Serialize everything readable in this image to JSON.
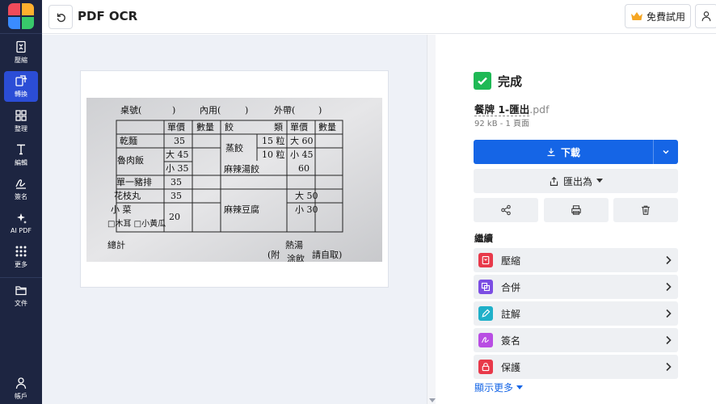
{
  "app": {
    "title": "PDF OCR",
    "trial_label": "免費試用"
  },
  "sidebar": {
    "items": [
      {
        "label": "壓縮",
        "icon": "compress-icon"
      },
      {
        "label": "轉換",
        "icon": "convert-icon",
        "active": true
      },
      {
        "label": "整理",
        "icon": "organize-icon"
      },
      {
        "label": "編輯",
        "icon": "edit-text-icon"
      },
      {
        "label": "簽名",
        "icon": "sign-icon"
      },
      {
        "label": "AI PDF",
        "icon": "ai-sparkle-icon"
      },
      {
        "label": "更多",
        "icon": "more-grid-icon"
      },
      {
        "label": "文件",
        "icon": "folder-icon"
      }
    ],
    "account_label": "帳戶"
  },
  "document": {
    "menu": {
      "header": [
        "桌號(",
        ")",
        "內用(",
        ")",
        "外帶(",
        ")"
      ],
      "col_headers_left": [
        "單價",
        "數量"
      ],
      "col_headers_right": [
        "餃",
        "類",
        "單價",
        "數量"
      ],
      "rows_left": [
        {
          "item": "乾麵",
          "price": "35"
        },
        {
          "item": "魯肉飯",
          "price": "大 45"
        },
        {
          "item": "",
          "price": "小 35"
        },
        {
          "item": "單一豬排",
          "price": "35"
        },
        {
          "item": "花枝丸",
          "price": "35"
        },
        {
          "item": "小 菜",
          "price": "20"
        },
        {
          "item": "□木耳 □小黃瓜",
          "price": ""
        }
      ],
      "rows_right": [
        {
          "item": "蒸餃",
          "qty": "15 粒",
          "price": "大 60"
        },
        {
          "item": "",
          "qty": "10 粒",
          "price": "小 45"
        },
        {
          "item": "麻辣湯餃",
          "qty": "",
          "price": "60"
        },
        {
          "item": "麻辣豆腐",
          "qty": "",
          "price": "大 50"
        },
        {
          "item": "",
          "qty": "",
          "price": "小 30"
        }
      ],
      "footer_total": "總計",
      "footer_note": "熱湯",
      "footer_note2": "(附",
      "footer_note3": "請自取)",
      "footer_note4": "涂飲"
    }
  },
  "panel": {
    "status": "完成",
    "file_name": "餐牌 1-匯出",
    "file_ext": ".pdf",
    "file_meta": "92 kB - 1 頁面",
    "download_label": "下載",
    "export_label": "匯出為",
    "continue_label": "繼續",
    "tools": [
      {
        "label": "壓縮",
        "icon": "compress-tool-icon",
        "color": "#e8394a"
      },
      {
        "label": "合併",
        "icon": "merge-tool-icon",
        "color": "#7b4de3"
      },
      {
        "label": "註解",
        "icon": "annotate-tool-icon",
        "color": "#1fb0c9"
      },
      {
        "label": "簽名",
        "icon": "sign-tool-icon",
        "color": "#b84de3"
      },
      {
        "label": "保護",
        "icon": "protect-tool-icon",
        "color": "#e8394a"
      }
    ],
    "show_more": "顯示更多"
  },
  "colors": {
    "accent": "#1565e6",
    "sidebar_bg": "#1d2541",
    "success": "#1fb955"
  }
}
